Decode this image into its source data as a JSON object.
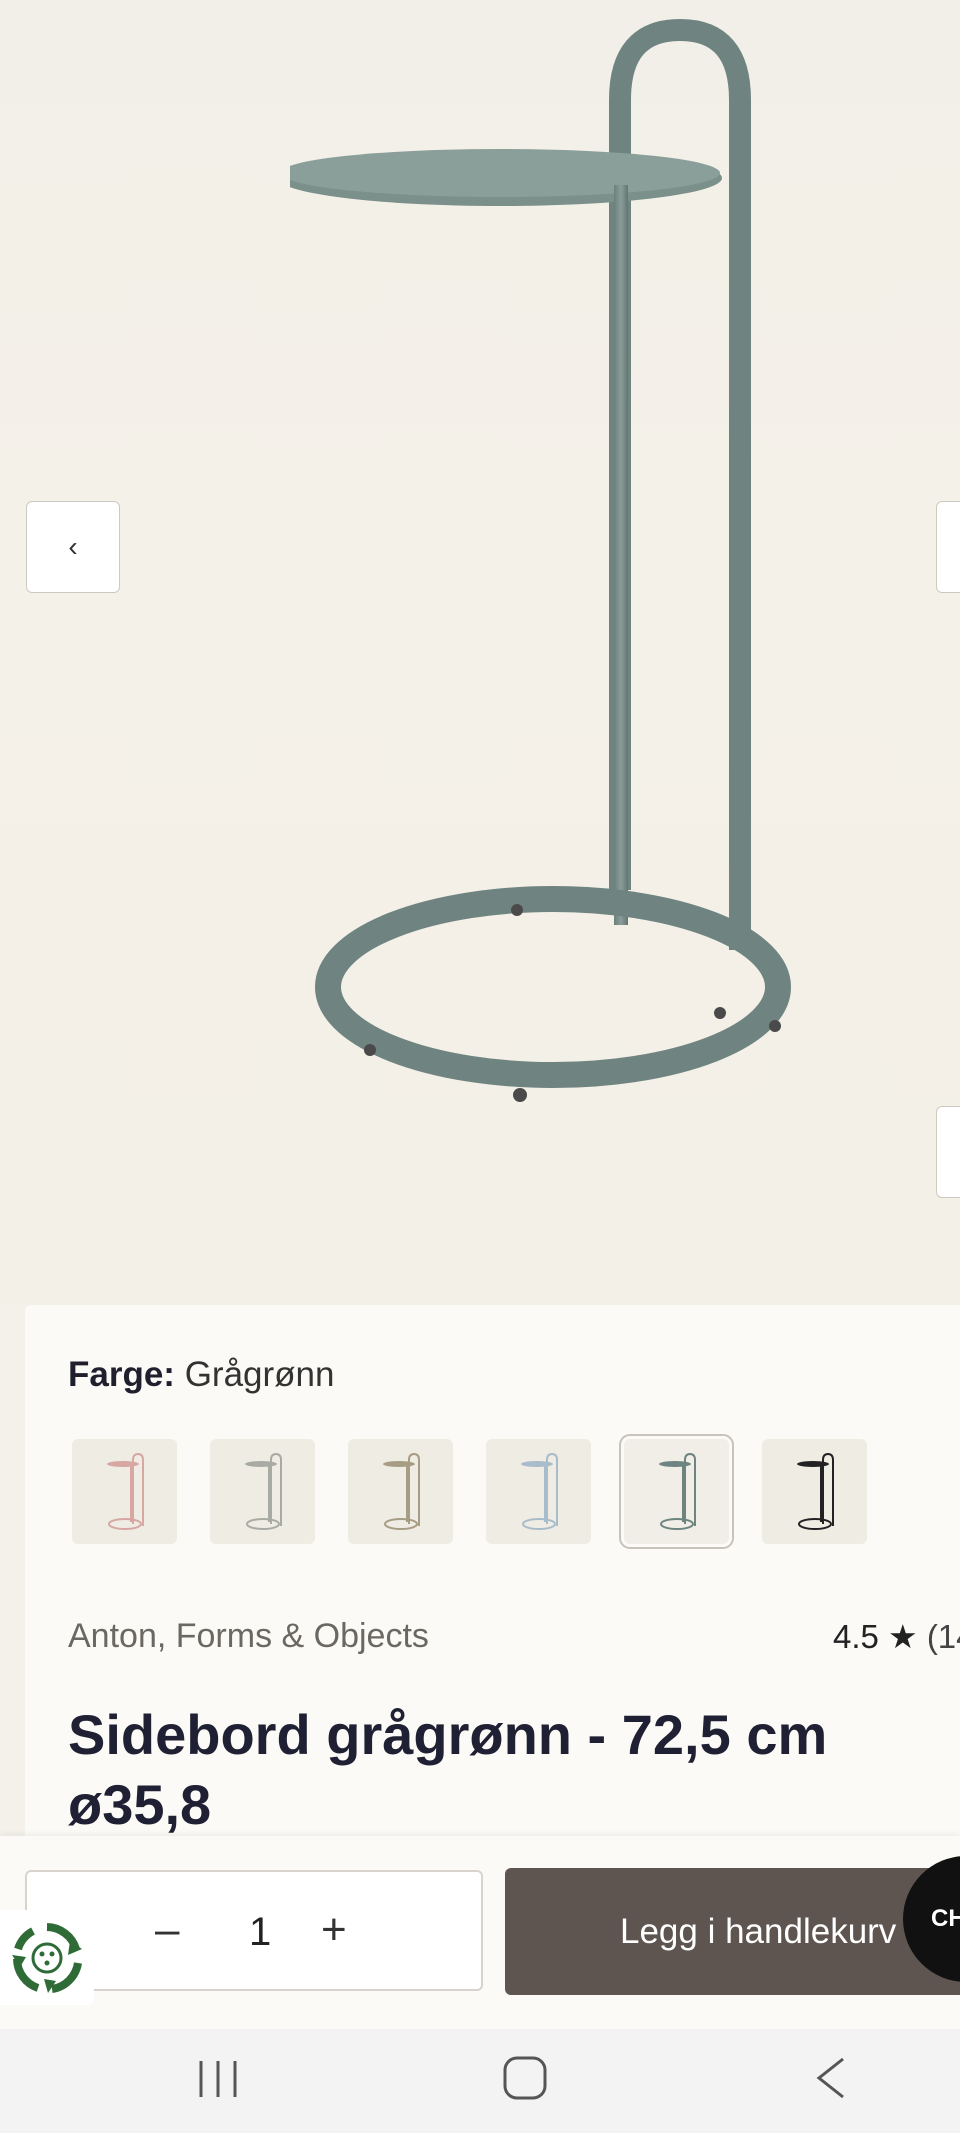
{
  "gallery": {
    "prev_icon": "chevron-left-icon",
    "prev_label": "‹",
    "next_icon": "chevron-right-icon"
  },
  "product": {
    "color_label": "Farge:",
    "color_value": "Grågrønn",
    "swatches": [
      {
        "name": "rosa",
        "color": "#d9a6a2"
      },
      {
        "name": "grå",
        "color": "#a8aba4"
      },
      {
        "name": "sand",
        "color": "#a79c84"
      },
      {
        "name": "lyseblå",
        "color": "#a9bccb"
      },
      {
        "name": "grågrønn",
        "color": "#6e8480",
        "selected": true
      },
      {
        "name": "svart",
        "color": "#222222"
      }
    ],
    "brand": "Anton, Forms & Objects",
    "rating": "4.5",
    "rating_star": "★",
    "rating_count": "(14",
    "title": "Sidebord grågrønn - 72,5 cm ø35,8",
    "product_color": "#7a8f8b"
  },
  "cart": {
    "qty_minus": "–",
    "qty_value": "1",
    "qty_plus": "+",
    "add_to_cart": "Legg i handlekurv",
    "chat_label": "CH",
    "button_color": "#5e5550"
  },
  "android_nav": {
    "recent_icon": "recent-apps-icon",
    "home_icon": "home-icon",
    "back_icon": "back-icon"
  }
}
